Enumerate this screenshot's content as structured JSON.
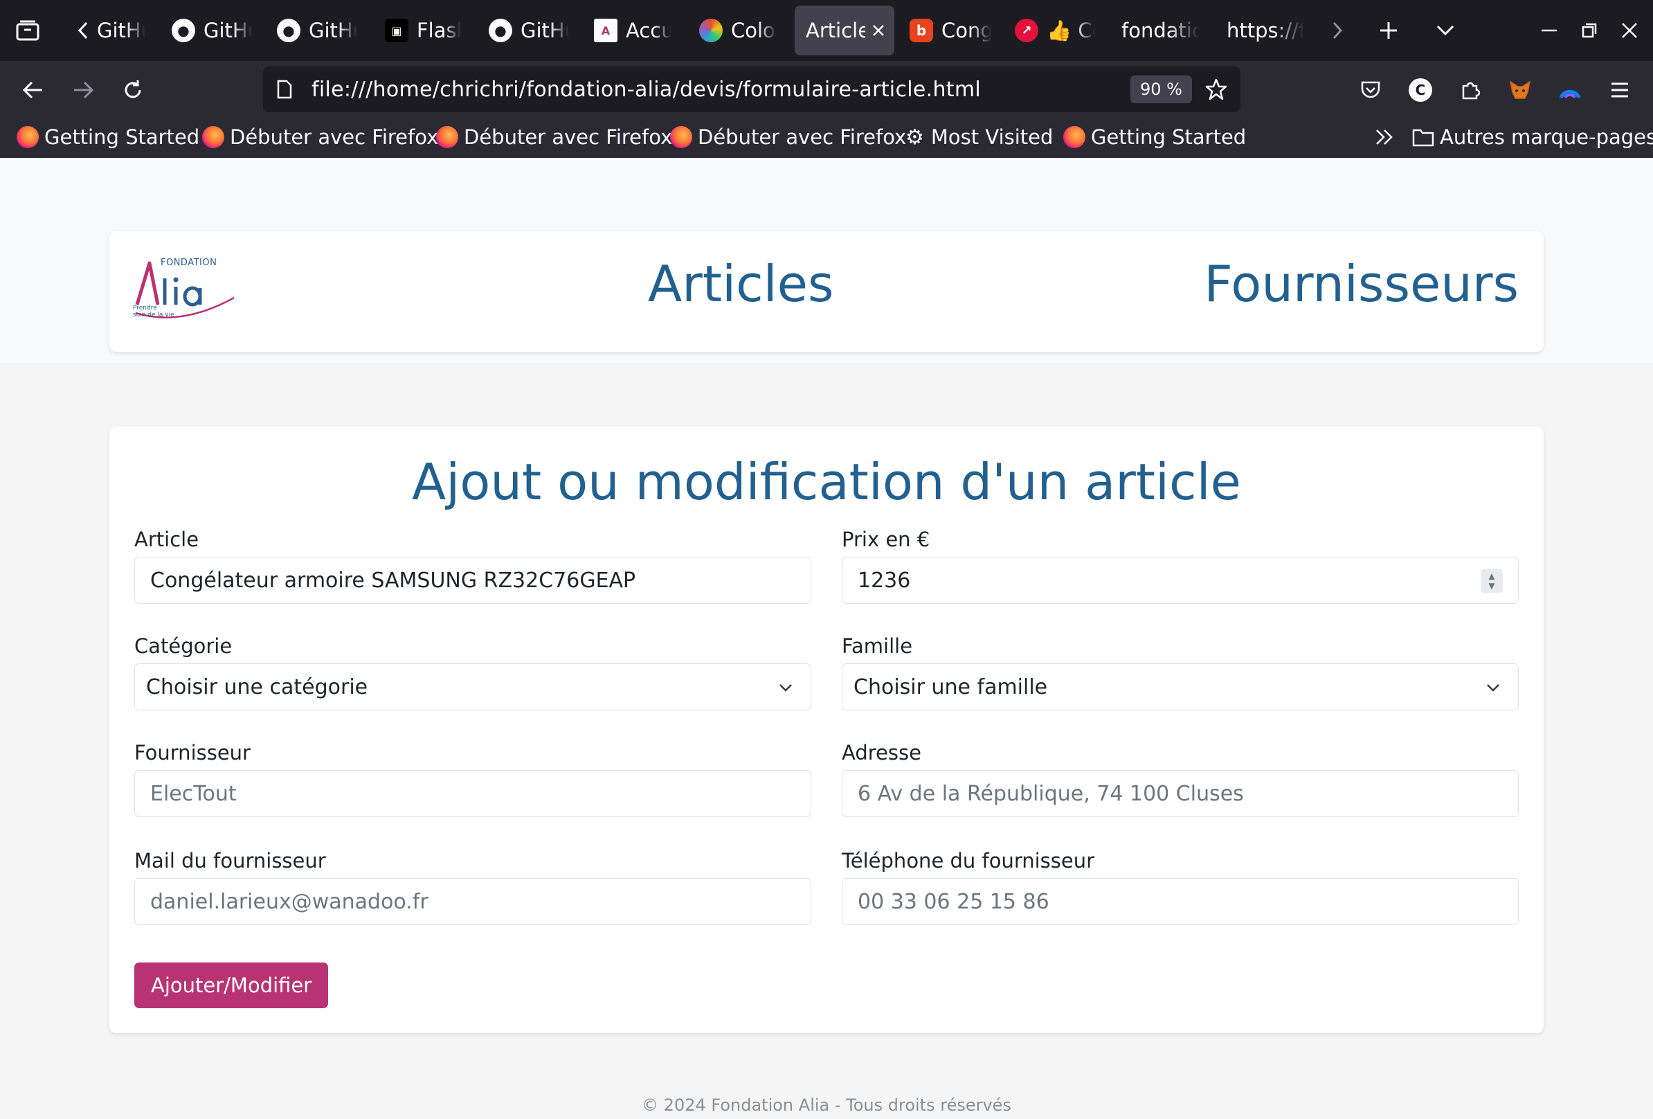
{
  "browser": {
    "tabs": [
      {
        "title": "GitHub",
        "icon": "github-icon"
      },
      {
        "title": "GitHub",
        "icon": "github-icon"
      },
      {
        "title": "GitHub",
        "icon": "github-icon"
      },
      {
        "title": "Flask",
        "icon": "flask-icon"
      },
      {
        "title": "GitHub",
        "icon": "github-icon"
      },
      {
        "title": "Accueil",
        "icon": "alia-icon"
      },
      {
        "title": "Colors",
        "icon": "color-wheel-icon"
      },
      {
        "title": "Article",
        "icon": "none",
        "active": true
      },
      {
        "title": "Congélateur",
        "icon": "b-icon"
      },
      {
        "title": "👍 Co",
        "icon": "red-arrow-icon"
      },
      {
        "title": "fondation",
        "icon": "none"
      },
      {
        "title": "https://f",
        "icon": "none"
      }
    ],
    "url": "file:///home/chrichri/fondation-alia/devis/formulaire-article.html",
    "zoom": "90 %",
    "bookmarks": [
      "Getting Started",
      "Débuter avec Firefox",
      "Débuter avec Firefox",
      "Débuter avec Firefox",
      "Most Visited",
      "Getting Started"
    ],
    "other_bookmarks": "Autres marque-pages"
  },
  "header": {
    "logo": {
      "top": "FONDATION",
      "name": "Alia",
      "tagline_1": "Prendre",
      "tagline_2": "soin de la vie"
    },
    "nav": {
      "articles": "Articles",
      "fournisseurs": "Fournisseurs"
    }
  },
  "form": {
    "title": "Ajout ou modification d'un article",
    "article": {
      "label": "Article",
      "value": "Congélateur armoire SAMSUNG RZ32C76GEAP"
    },
    "prix": {
      "label": "Prix en €",
      "value": "1236"
    },
    "categorie": {
      "label": "Catégorie",
      "value": "Choisir une catégorie"
    },
    "famille": {
      "label": "Famille",
      "value": "Choisir une famille"
    },
    "fournisseur": {
      "label": "Fournisseur",
      "placeholder": "ElecTout"
    },
    "adresse": {
      "label": "Adresse",
      "placeholder": "6 Av de la République, 74 100 Cluses"
    },
    "mail": {
      "label": "Mail du fournisseur",
      "placeholder": "daniel.larieux@wanadoo.fr"
    },
    "telephone": {
      "label": "Téléphone du fournisseur",
      "placeholder": "00 33 06 25 15 86"
    },
    "submit_label": "Ajouter/Modifier"
  },
  "footer": "© 2024 Fondation Alia - Tous droits réservés",
  "colors": {
    "brand_blue": "#22608f",
    "brand_magenta": "#b83373"
  }
}
